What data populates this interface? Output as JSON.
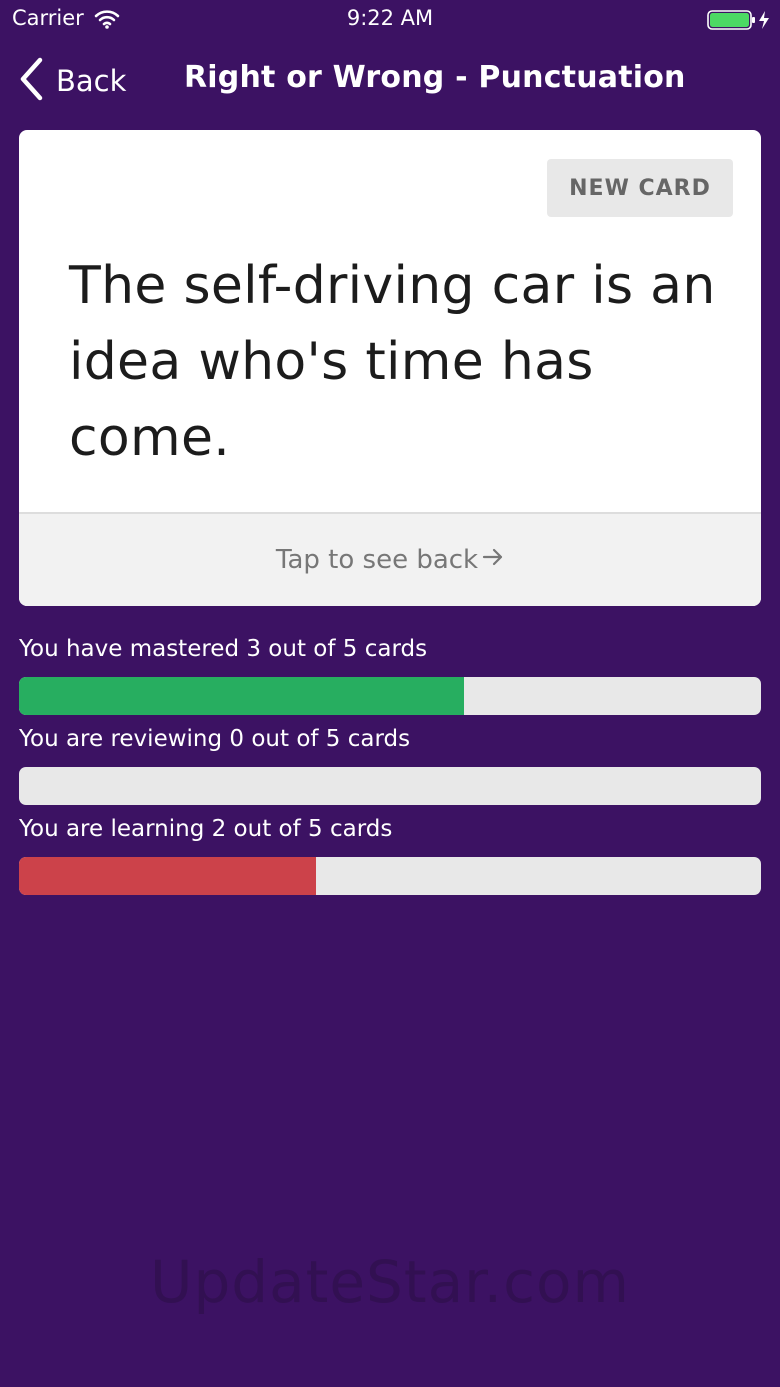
{
  "status_bar": {
    "carrier": "Carrier",
    "time": "9:22 AM"
  },
  "nav": {
    "back_label": "Back",
    "title": "Right or Wrong - Punctuation"
  },
  "card": {
    "new_card_label": "NEW CARD",
    "front_text": "The self-driving car is an idea who's time has come.",
    "footer_label": "Tap to see back"
  },
  "progress": [
    {
      "label": "You have mastered 3 out of 5 cards",
      "count": 3,
      "total": 5,
      "color": "#27ae60"
    },
    {
      "label": "You are reviewing 0 out of 5 cards",
      "count": 0,
      "total": 5,
      "color": "#f39c12"
    },
    {
      "label": "You are learning 2 out of 5 cards",
      "count": 2,
      "total": 5,
      "color": "#cc424a"
    }
  ],
  "watermark": "UpdateStar.com"
}
